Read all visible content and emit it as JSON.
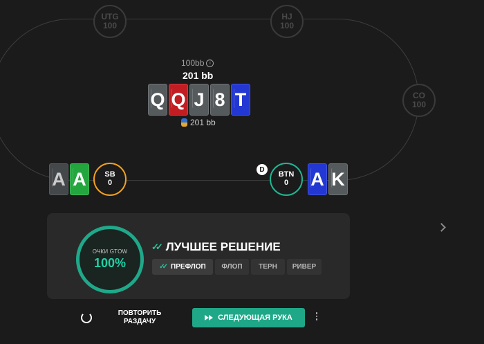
{
  "seats": {
    "utg": {
      "name": "UTG",
      "stack": "100"
    },
    "hj": {
      "name": "HJ",
      "stack": "100"
    },
    "co": {
      "name": "CO",
      "stack": "100"
    },
    "sb": {
      "name": "SB",
      "stack": "0"
    },
    "btn": {
      "name": "BTN",
      "stack": "0"
    }
  },
  "center": {
    "effective_stack": "100bb",
    "stack": "201 bb",
    "board": [
      {
        "rank": "Q",
        "color": "black"
      },
      {
        "rank": "Q",
        "color": "red"
      },
      {
        "rank": "J",
        "color": "black"
      },
      {
        "rank": "8",
        "color": "black"
      },
      {
        "rank": "T",
        "color": "blue"
      }
    ],
    "pot": "201 bb"
  },
  "sb_hand": [
    {
      "rank": "A",
      "color": "black"
    },
    {
      "rank": "A",
      "color": "green"
    }
  ],
  "btn_hand": [
    {
      "rank": "A",
      "color": "blue"
    },
    {
      "rank": "K",
      "color": "black"
    }
  ],
  "dealer_label": "D",
  "result": {
    "score_label": "ОЧКИ GTOW",
    "score_value": "100%",
    "title": "ЛУЧШЕЕ РЕШЕНИЕ",
    "streets": [
      "ПРЕФЛОП",
      "ФЛОП",
      "ТЕРН",
      "РИВЕР"
    ],
    "active_street": "ПРЕФЛОП"
  },
  "actions": {
    "repeat_label": "ПОВТОРИТЬ РАЗДАЧУ",
    "next_label": "СЛЕДУЮЩАЯ РУКА"
  },
  "colors": {
    "accent": "#1fa887",
    "sb_ring": "#f0a022",
    "btn_ring": "#1fb795",
    "background": "#1b1b1b"
  },
  "icons": [
    "info-icon",
    "chips-icon",
    "double-check-icon",
    "repeat-icon",
    "fast-forward-icon",
    "more-vertical-icon",
    "chevron-right-icon"
  ]
}
